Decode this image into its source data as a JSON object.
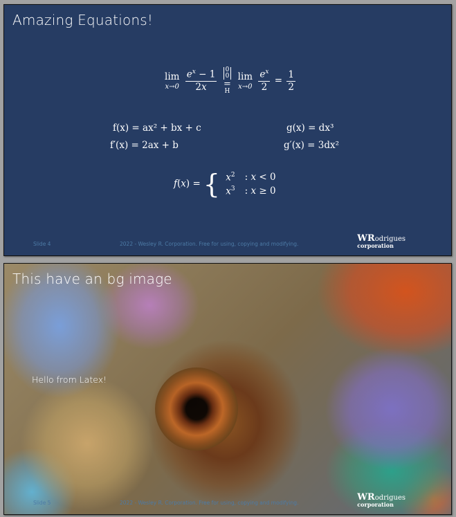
{
  "slides": [
    {
      "title": "Amazing Equations!",
      "footer_slide": "Slide 4",
      "footer_text": "2022 - Wesley R. Corporation. Free for using, copying and modifying.",
      "logo_w": "WR",
      "logo_rest": "odrigues",
      "logo_corp": "corporation",
      "equations": {
        "f": "f(x) = ax² + bx + c",
        "fprime": "f′(x) = 2ax + b",
        "g": "g(x) = dx³",
        "gprime": "g′(x) = 3dx²"
      }
    },
    {
      "title": "This have an bg image",
      "body_text": "Hello from Latex!",
      "footer_slide": "Slide 5",
      "footer_text": "2022 - Wesley R. Corporation. Free for using, copying and modifying.",
      "logo_w": "WR",
      "logo_rest": "odrigues",
      "logo_corp": "corporation"
    }
  ],
  "colors": {
    "slide_bg": "#263c63",
    "canvas_bg": "#a2a2a2",
    "footer_text": "#4d7ba6"
  }
}
